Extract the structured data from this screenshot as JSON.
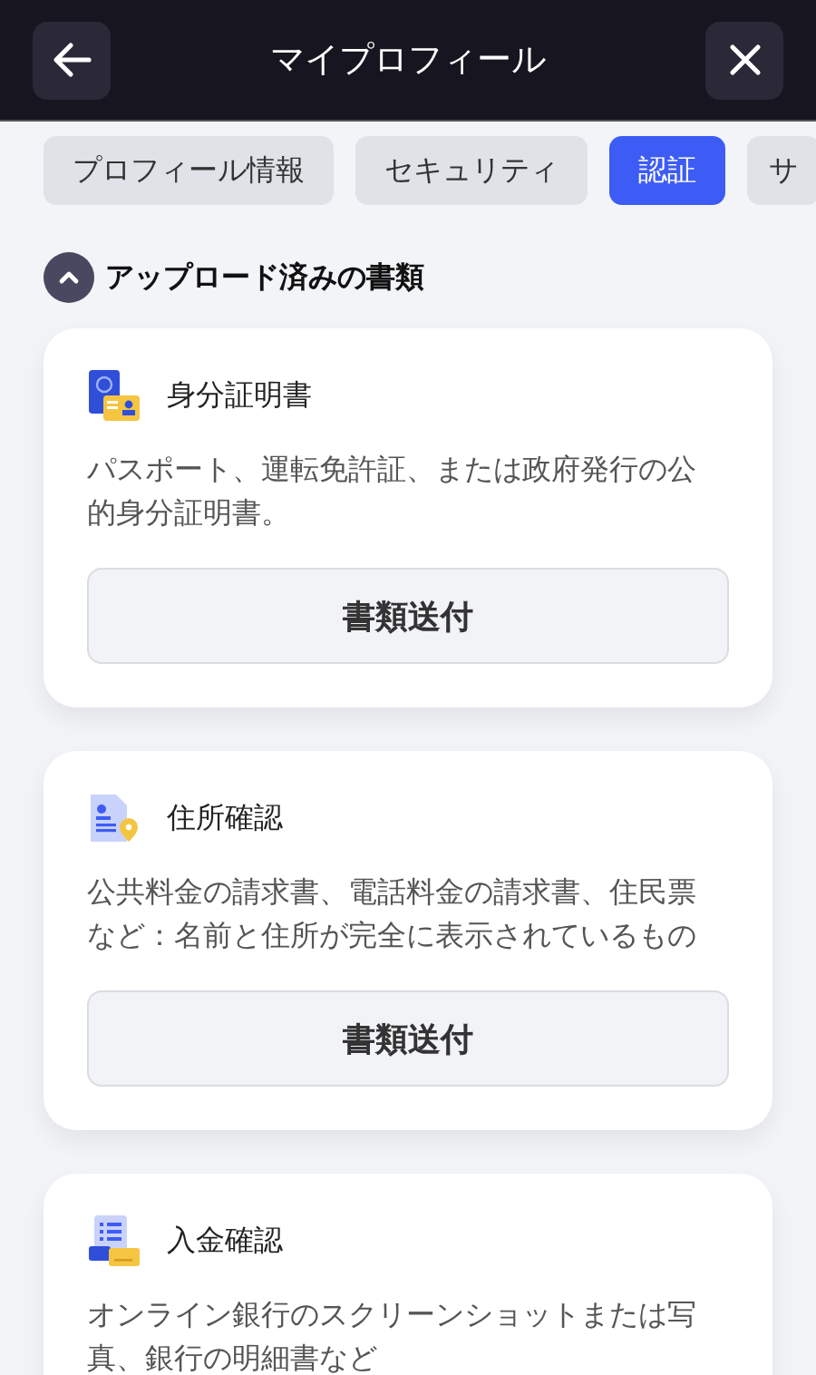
{
  "header": {
    "title": "マイプロフィール"
  },
  "tabs": [
    {
      "label": "プロフィール情報",
      "selected": false
    },
    {
      "label": "セキュリティ",
      "selected": false
    },
    {
      "label": "認証",
      "selected": true
    },
    {
      "label": "サ",
      "selected": false
    }
  ],
  "section": {
    "title": "アップロード済みの書類",
    "expanded": true
  },
  "documents": [
    {
      "kind": "id",
      "title": "身分証明書",
      "description": "パスポート、運転免許証、または政府発行の公的身分証明書。",
      "button": "書類送付"
    },
    {
      "kind": "address",
      "title": "住所確認",
      "description": "公共料金の請求書、電話料金の請求書、住民票など：名前と住所が完全に表示されているもの",
      "button": "書類送付"
    },
    {
      "kind": "payment",
      "title": "入金確認",
      "description": "オンライン銀行のスクリーンショットまたは写真、銀行の明細書など"
    }
  ]
}
